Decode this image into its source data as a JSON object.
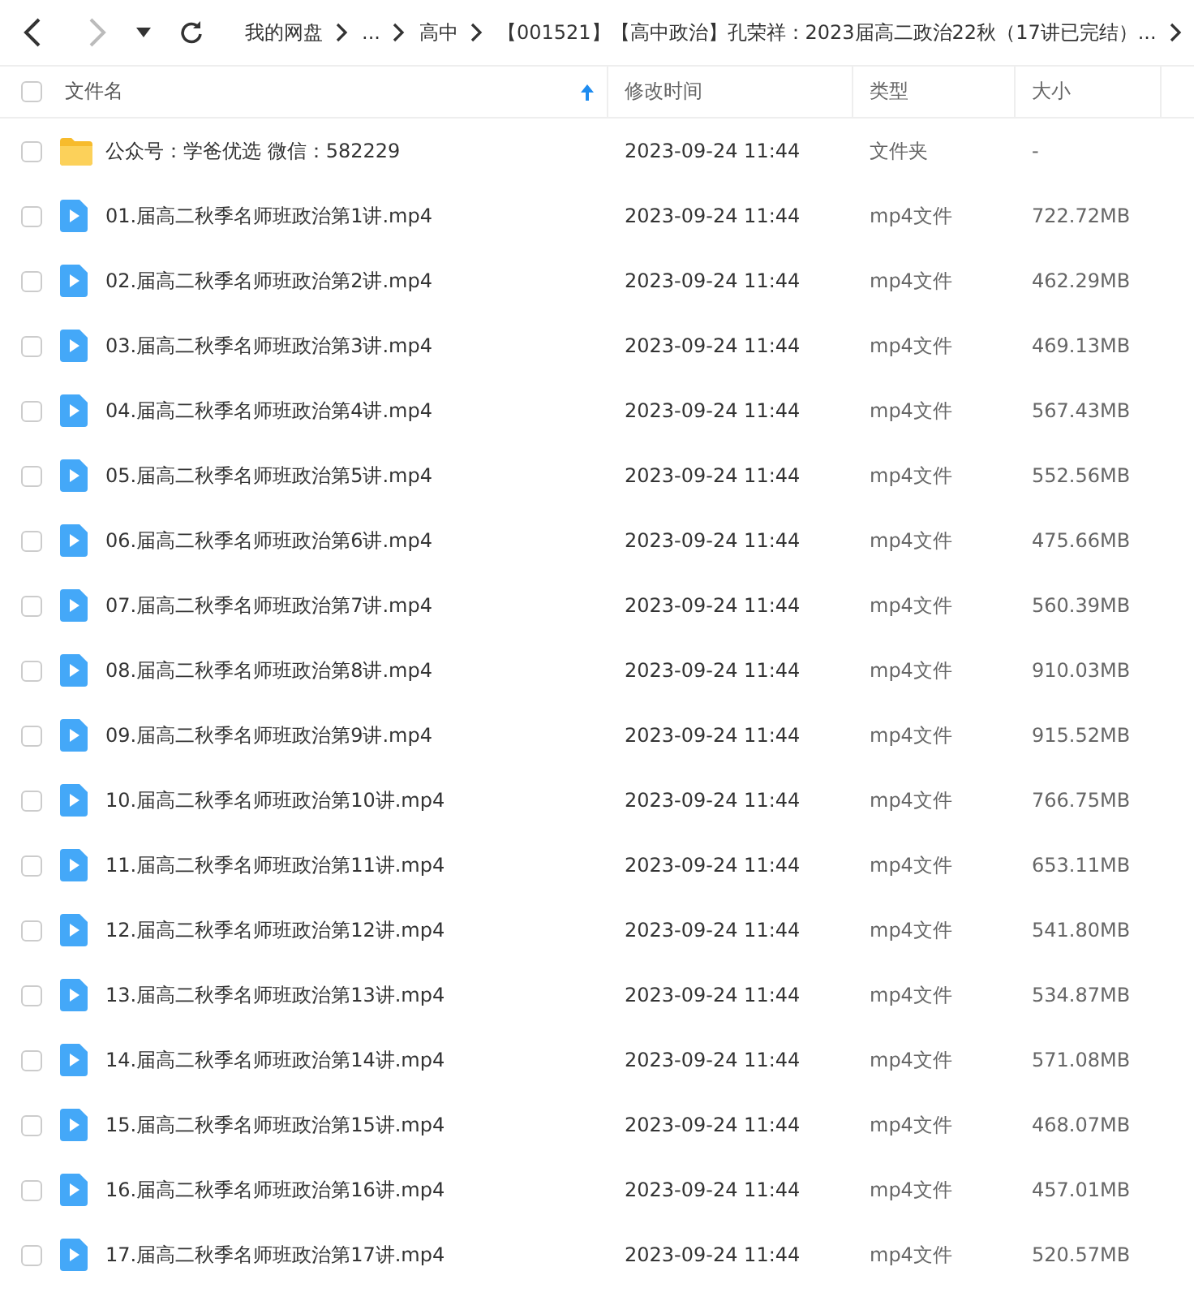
{
  "toolbar": {
    "breadcrumbs": [
      {
        "label": "我的网盘"
      },
      {
        "label": "..."
      },
      {
        "label": "高中"
      },
      {
        "label": "【001521】【高中政治】孔荣祥：2023届高二政治22秋（17讲已完结）..."
      }
    ]
  },
  "table": {
    "select_all": {
      "checked": false
    },
    "columns": [
      {
        "label": "文件名",
        "sorted": true
      },
      {
        "label": "修改时间",
        "sorted": false
      },
      {
        "label": "类型",
        "sorted": false
      },
      {
        "label": "大小",
        "sorted": false
      }
    ],
    "rows": [
      {
        "kind": "folder",
        "name": "公众号：学爸优选 微信：582229",
        "modified": "2023-09-24 11:44",
        "type": "文件夹",
        "size": "-",
        "checked": false
      },
      {
        "kind": "video",
        "name": "01.届高二秋季名师班政治第1讲.mp4",
        "modified": "2023-09-24 11:44",
        "type": "mp4文件",
        "size": "722.72MB",
        "checked": false
      },
      {
        "kind": "video",
        "name": "02.届高二秋季名师班政治第2讲.mp4",
        "modified": "2023-09-24 11:44",
        "type": "mp4文件",
        "size": "462.29MB",
        "checked": false
      },
      {
        "kind": "video",
        "name": "03.届高二秋季名师班政治第3讲.mp4",
        "modified": "2023-09-24 11:44",
        "type": "mp4文件",
        "size": "469.13MB",
        "checked": false
      },
      {
        "kind": "video",
        "name": "04.届高二秋季名师班政治第4讲.mp4",
        "modified": "2023-09-24 11:44",
        "type": "mp4文件",
        "size": "567.43MB",
        "checked": false
      },
      {
        "kind": "video",
        "name": "05.届高二秋季名师班政治第5讲.mp4",
        "modified": "2023-09-24 11:44",
        "type": "mp4文件",
        "size": "552.56MB",
        "checked": false
      },
      {
        "kind": "video",
        "name": "06.届高二秋季名师班政治第6讲.mp4",
        "modified": "2023-09-24 11:44",
        "type": "mp4文件",
        "size": "475.66MB",
        "checked": false
      },
      {
        "kind": "video",
        "name": "07.届高二秋季名师班政治第7讲.mp4",
        "modified": "2023-09-24 11:44",
        "type": "mp4文件",
        "size": "560.39MB",
        "checked": false
      },
      {
        "kind": "video",
        "name": "08.届高二秋季名师班政治第8讲.mp4",
        "modified": "2023-09-24 11:44",
        "type": "mp4文件",
        "size": "910.03MB",
        "checked": false
      },
      {
        "kind": "video",
        "name": "09.届高二秋季名师班政治第9讲.mp4",
        "modified": "2023-09-24 11:44",
        "type": "mp4文件",
        "size": "915.52MB",
        "checked": false
      },
      {
        "kind": "video",
        "name": "10.届高二秋季名师班政治第10讲.mp4",
        "modified": "2023-09-24 11:44",
        "type": "mp4文件",
        "size": "766.75MB",
        "checked": false
      },
      {
        "kind": "video",
        "name": "11.届高二秋季名师班政治第11讲.mp4",
        "modified": "2023-09-24 11:44",
        "type": "mp4文件",
        "size": "653.11MB",
        "checked": false
      },
      {
        "kind": "video",
        "name": "12.届高二秋季名师班政治第12讲.mp4",
        "modified": "2023-09-24 11:44",
        "type": "mp4文件",
        "size": "541.80MB",
        "checked": false
      },
      {
        "kind": "video",
        "name": "13.届高二秋季名师班政治第13讲.mp4",
        "modified": "2023-09-24 11:44",
        "type": "mp4文件",
        "size": "534.87MB",
        "checked": false
      },
      {
        "kind": "video",
        "name": "14.届高二秋季名师班政治第14讲.mp4",
        "modified": "2023-09-24 11:44",
        "type": "mp4文件",
        "size": "571.08MB",
        "checked": false
      },
      {
        "kind": "video",
        "name": "15.届高二秋季名师班政治第15讲.mp4",
        "modified": "2023-09-24 11:44",
        "type": "mp4文件",
        "size": "468.07MB",
        "checked": false
      },
      {
        "kind": "video",
        "name": "16.届高二秋季名师班政治第16讲.mp4",
        "modified": "2023-09-24 11:44",
        "type": "mp4文件",
        "size": "457.01MB",
        "checked": false
      },
      {
        "kind": "video",
        "name": "17.届高二秋季名师班政治第17讲.mp4",
        "modified": "2023-09-24 11:44",
        "type": "mp4文件",
        "size": "520.57MB",
        "checked": false
      }
    ]
  }
}
